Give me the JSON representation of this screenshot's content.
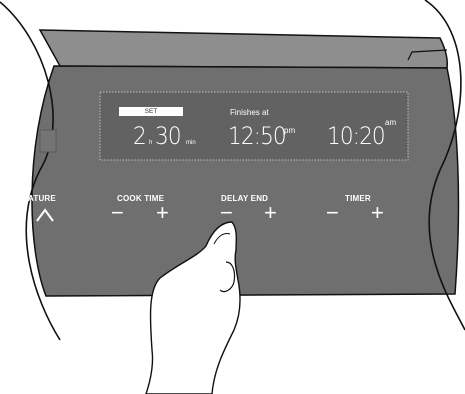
{
  "display": {
    "set_badge": "SET",
    "cook_time": {
      "hours": "2",
      "hours_unit": "h",
      "minutes": "30",
      "minutes_unit": "min"
    },
    "finishes": {
      "label": "Finishes at",
      "time": "12:50",
      "meridiem": "pm"
    },
    "clock": {
      "time": "10:20",
      "meridiem": "am"
    }
  },
  "controls": {
    "temperature": {
      "label": "RATURE",
      "icon": "chevron-up-icon"
    },
    "cook_time": {
      "label": "COOK TIME",
      "minus": "−",
      "plus": "+"
    },
    "delay_end": {
      "label": "DELAY END",
      "minus": "−",
      "plus": "+"
    },
    "timer": {
      "label": "TIMER",
      "minus": "−",
      "plus": "+"
    }
  },
  "colors": {
    "panel": "#6f6f6f",
    "panel_top": "#8e8e8e",
    "display": "#626262",
    "text": "#ffffff"
  }
}
